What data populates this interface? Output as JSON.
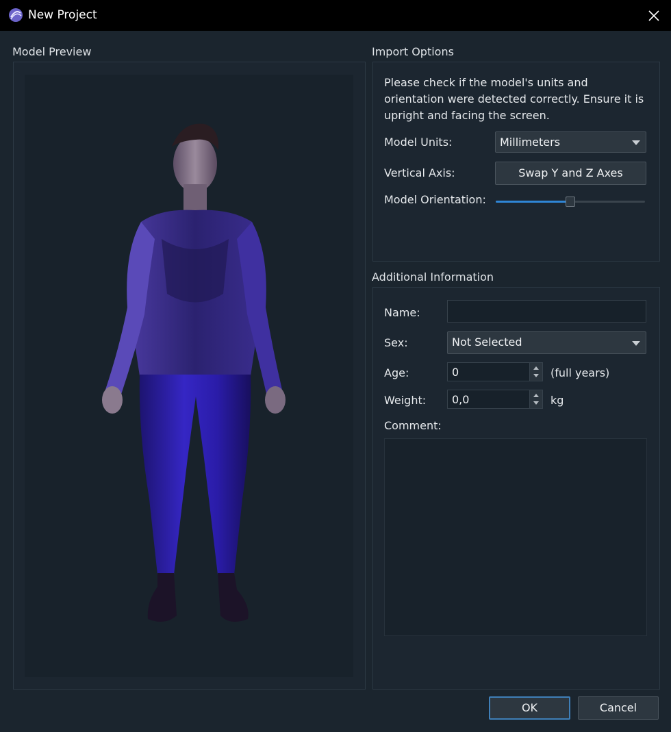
{
  "window": {
    "title": "New Project"
  },
  "preview": {
    "section_label": "Model Preview"
  },
  "import_options": {
    "section_label": "Import Options",
    "description": "Please check if the model's units and orientation were detected correctly. Ensure it is upright and facing the screen.",
    "units_label": "Model Units:",
    "units_value": "Millimeters",
    "axis_label": "Vertical Axis:",
    "swap_button": "Swap Y and Z Axes",
    "orientation_label": "Model Orientation:",
    "orientation_fraction": 0.5
  },
  "additional_info": {
    "section_label": "Additional Information",
    "name_label": "Name:",
    "name_value": "",
    "sex_label": "Sex:",
    "sex_value": "Not Selected",
    "age_label": "Age:",
    "age_value": "0",
    "age_unit": "(full years)",
    "weight_label": "Weight:",
    "weight_value": "0,0",
    "weight_unit": "kg",
    "comment_label": "Comment:"
  },
  "footer": {
    "ok": "OK",
    "cancel": "Cancel"
  },
  "colors": {
    "accent": "#2f86d6",
    "background": "#1b252e",
    "model": "#2e1fa6"
  }
}
